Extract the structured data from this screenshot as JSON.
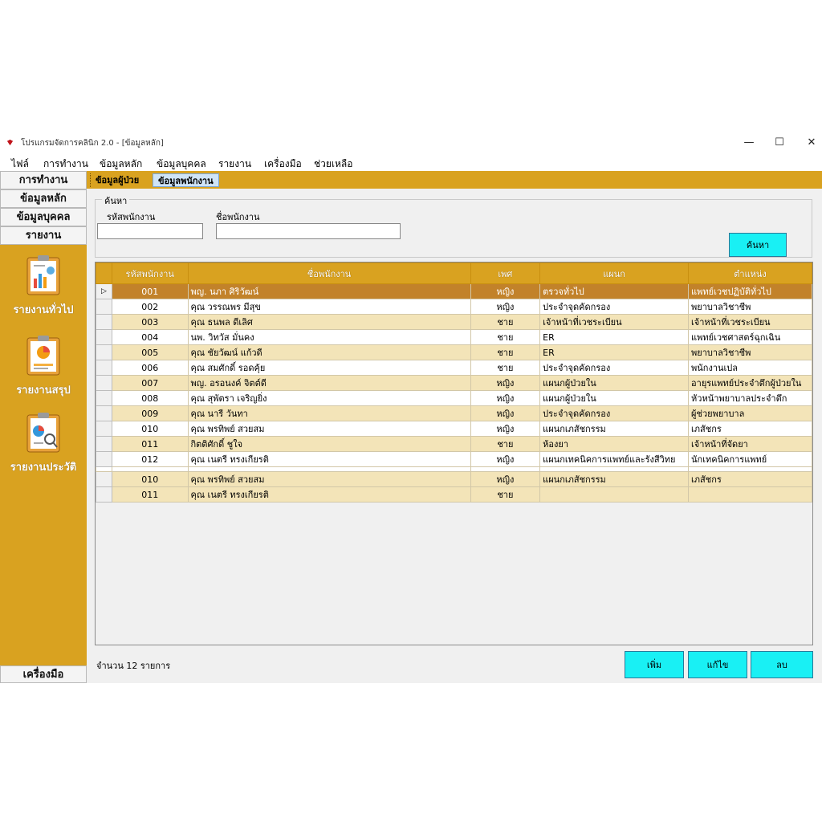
{
  "window": {
    "title": "โปรแกรมจัดการคลินิก 2.0 - [ข้อมูลหลัก]",
    "minimize": "—",
    "maximize": "☐",
    "close": "✕"
  },
  "menu": [
    "ไฟล์",
    "การทำงาน",
    "ข้อมูลหลัก",
    "ข้อมูลบุคคล",
    "รายงาน",
    "เครื่องมือ",
    "ช่วยเหลือ"
  ],
  "tabs": [
    "ข้อมูลผู้ป่วย",
    "ข้อมูลพนักงาน"
  ],
  "sidebar": {
    "sections": [
      "การทำงาน",
      "ข้อมูลหลัก",
      "ข้อมูลบุคคล",
      "รายงาน"
    ],
    "reports": [
      {
        "label": "รายงานทั่วไป",
        "icon": "general-report-icon"
      },
      {
        "label": "รายงานสรุป",
        "icon": "summary-report-icon"
      },
      {
        "label": "รายงานประวัติ",
        "icon": "history-report-icon"
      }
    ],
    "tools": "เครื่องมือ"
  },
  "search": {
    "legend": "ค้นหา",
    "code_label": "รหัสพนักงาน",
    "name_label": "ชื่อพนักงาน",
    "code_value": "",
    "name_value": "",
    "button": "ค้นหา"
  },
  "table": {
    "columns": [
      "รหัสพนักงาน",
      "ชื่อพนักงาน",
      "เพศ",
      "แผนก",
      "ตำแหน่ง"
    ],
    "rows": [
      [
        "001",
        "พญ. นภา ศิริวัฒน์",
        "หญิง",
        "ตรวจทั่วไป",
        "แพทย์เวชปฏิบัติทั่วไป"
      ],
      [
        "002",
        "คุณ วรรณพร มีสุข",
        "หญิง",
        "ประจำจุดคัดกรอง",
        "พยาบาลวิชาชีพ"
      ],
      [
        "003",
        "คุณ ธนพล ดีเลิศ",
        "ชาย",
        "เจ้าหน้าที่เวชระเบียน",
        "เจ้าหน้าที่เวชระเบียน"
      ],
      [
        "004",
        "นพ. วิทวัส มั่นคง",
        "ชาย",
        "ER",
        "แพทย์เวชศาสตร์ฉุกเฉิน"
      ],
      [
        "005",
        "คุณ ชัยวัฒน์ แก้วดี",
        "ชาย",
        "ER",
        "พยาบาลวิชาชีพ"
      ],
      [
        "006",
        "คุณ สมศักดิ์ รอดคุ้ย",
        "ชาย",
        "ประจำจุดคัดกรอง",
        "พนักงานเปล"
      ],
      [
        "007",
        "พญ. อรอนงค์ จิตต์ดี",
        "หญิง",
        "แผนกผู้ป่วยใน",
        "อายุรแพทย์ประจำตึกผู้ป่วยใน"
      ],
      [
        "008",
        "คุณ สุพัตรา เจริญยิ่ง",
        "หญิง",
        "แผนกผู้ป่วยใน",
        "หัวหน้าพยาบาลประจำตึก"
      ],
      [
        "009",
        "คุณ นารี วันทา",
        "หญิง",
        "ประจำจุดคัดกรอง",
        "ผู้ช่วยพยาบาล"
      ],
      [
        "010",
        "คุณ พรทิพย์ สวยสม",
        "หญิง",
        "แผนกเภสัชกรรม",
        "เภสัชกร"
      ],
      [
        "011",
        "กิตติศักดิ์ ชูใจ",
        "ชาย",
        "ห้องยา",
        "เจ้าหน้าที่จัดยา"
      ],
      [
        "012",
        "คุณ เนตรี ทรงเกียรติ",
        "หญิง",
        "แผนกเทคนิคการแพทย์และรังสีวิทย",
        "นักเทคนิคการแพทย์"
      ],
      [
        "010",
        "คุณ พรทิพย์ สวยสม",
        "หญิง",
        "แผนกเภสัชกรรม",
        "เภสัชกร"
      ],
      [
        "011",
        "คุณ เนตรี ทรงเกียรติ",
        "ชาย",
        "",
        ""
      ]
    ]
  },
  "footer": {
    "count": "จำนวน 12 รายการ",
    "add": "เพิ่ม",
    "edit": "แก้ไข",
    "delete": "ลบ"
  },
  "colors": {
    "accent": "#d9a220",
    "row_alt": "#f3e4b8",
    "row_selected": "#c2822a",
    "button": "#19f0f4",
    "tab_active": "#cfe4f7"
  }
}
